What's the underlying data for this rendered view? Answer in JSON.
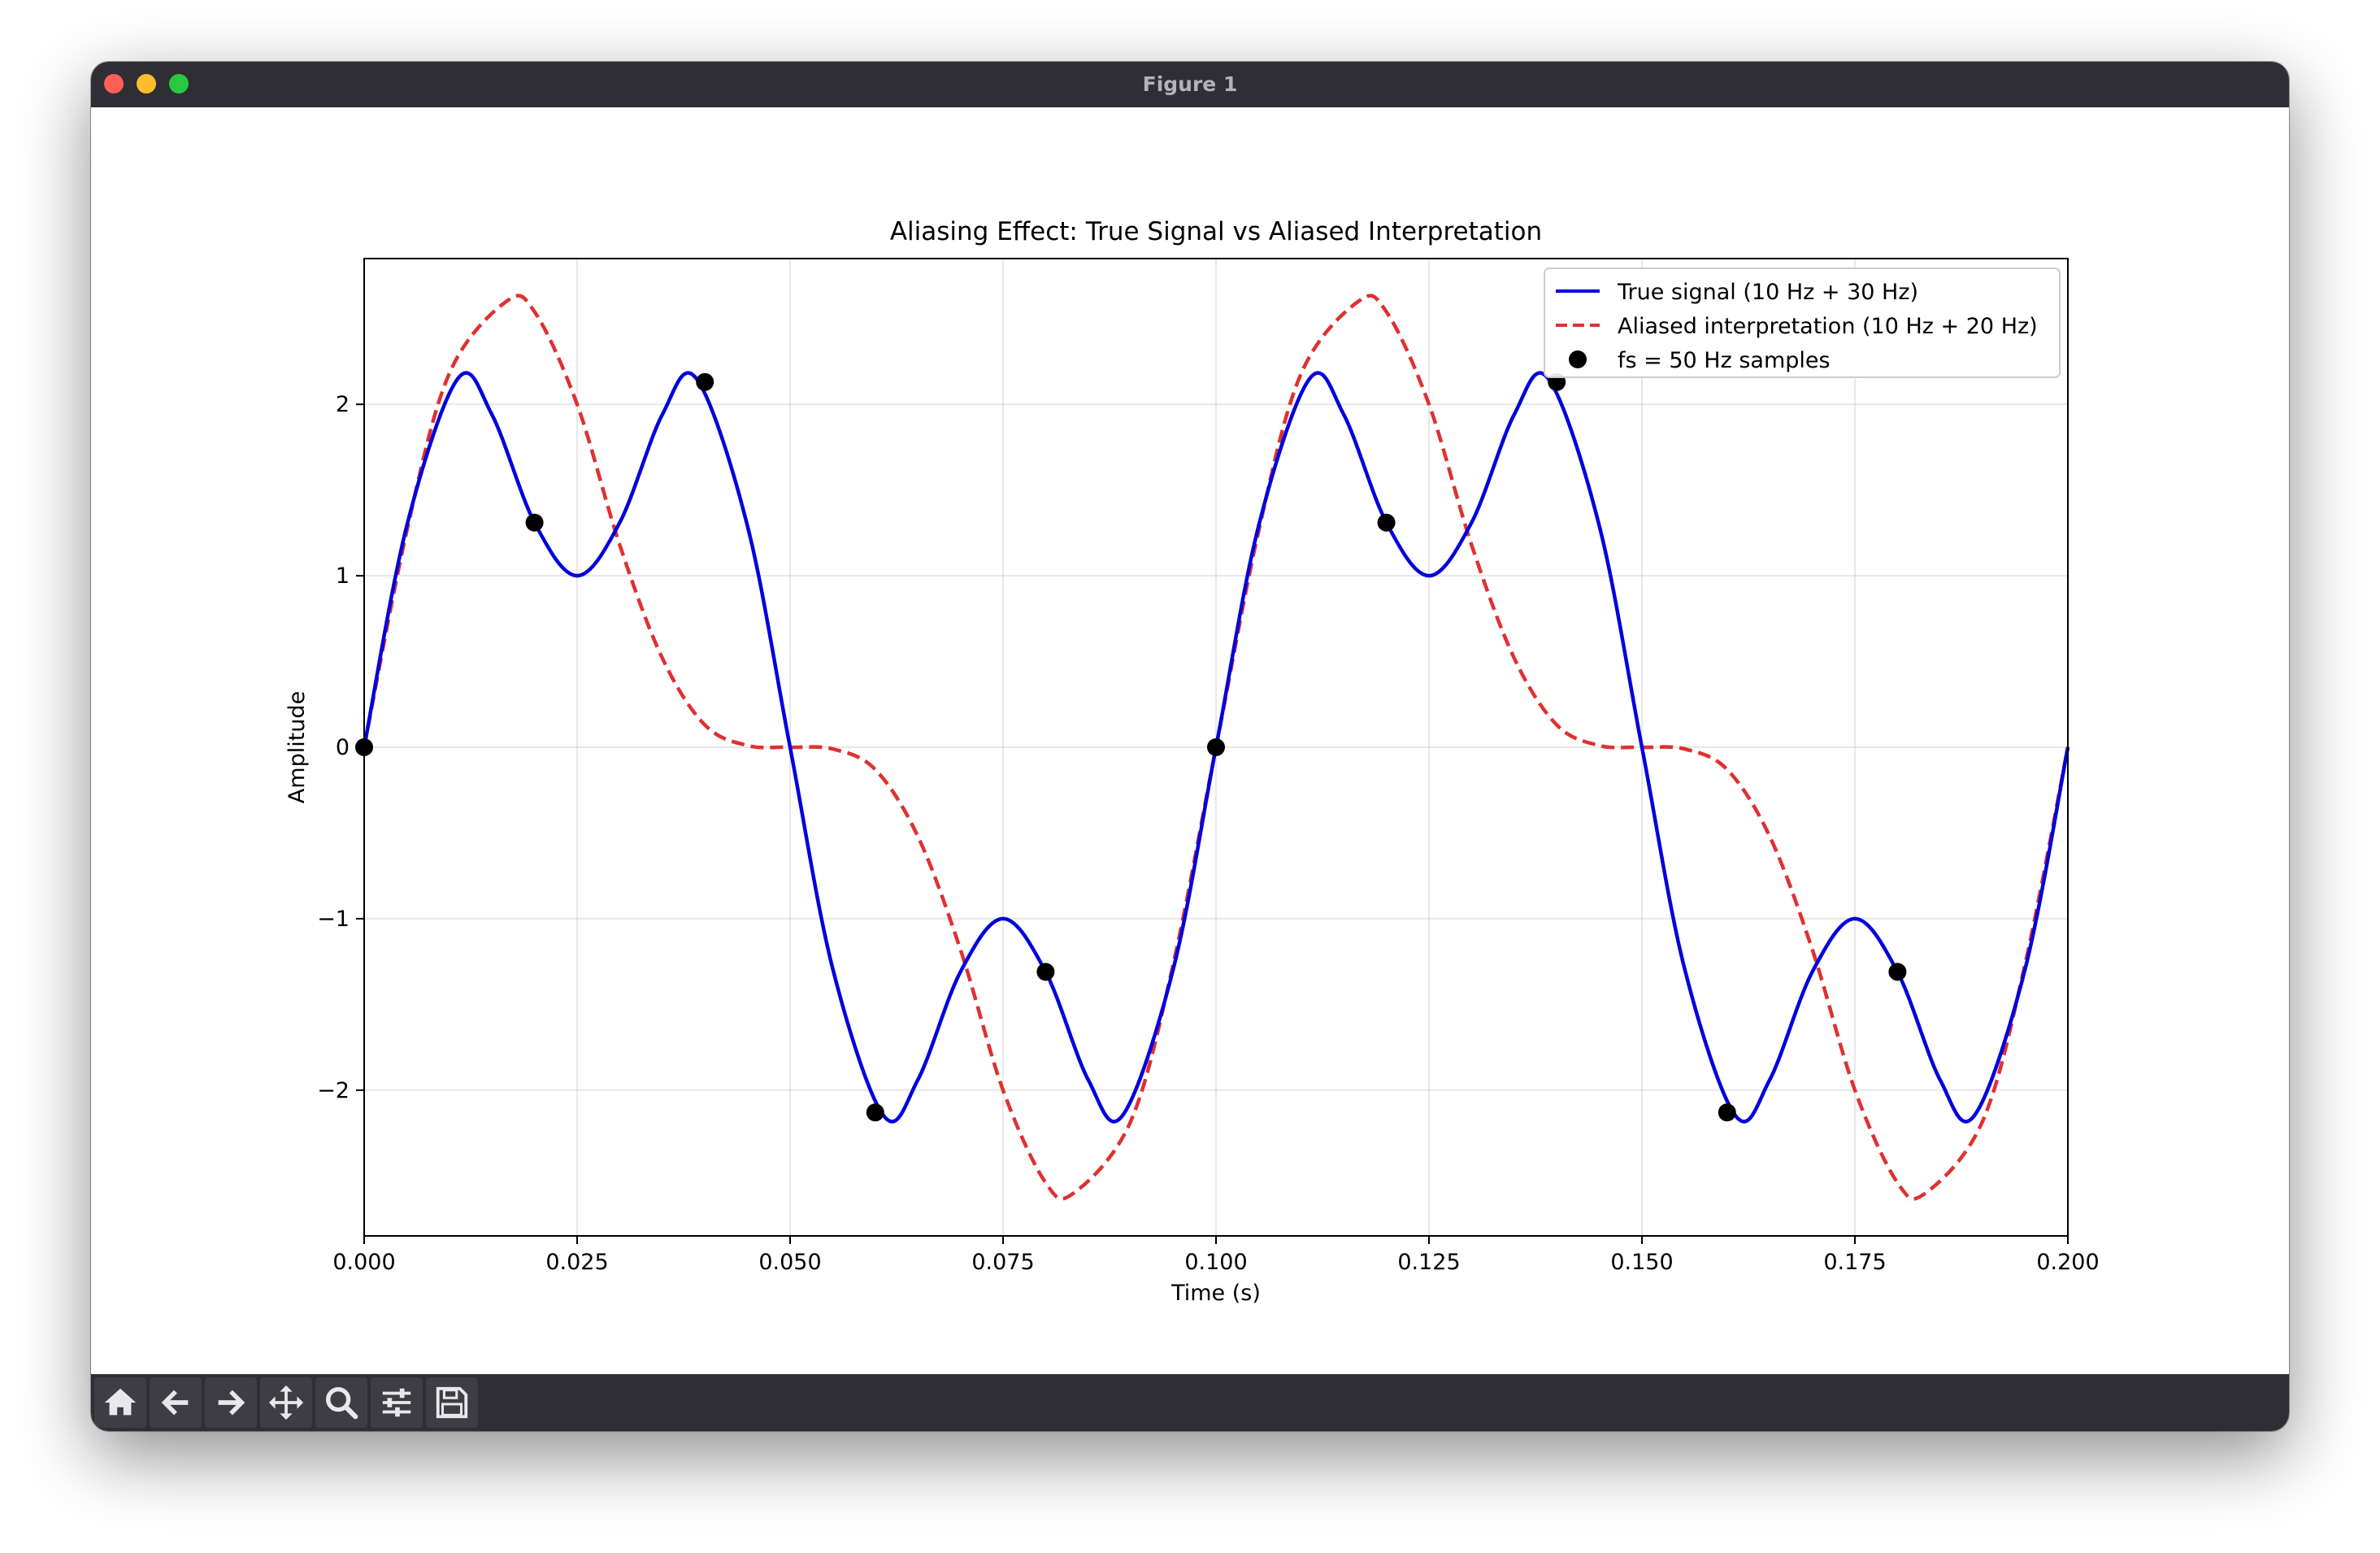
{
  "window": {
    "title": "Figure 1"
  },
  "toolbar": {
    "buttons": [
      {
        "name": "home-button",
        "icon": "home-icon"
      },
      {
        "name": "back-button",
        "icon": "arrow-left-icon"
      },
      {
        "name": "forward-button",
        "icon": "arrow-right-icon"
      },
      {
        "name": "pan-button",
        "icon": "move-icon"
      },
      {
        "name": "zoom-button",
        "icon": "magnifier-icon"
      },
      {
        "name": "configure-subplots-button",
        "icon": "sliders-icon"
      },
      {
        "name": "save-button",
        "icon": "floppy-disk-icon"
      }
    ]
  },
  "chart_data": {
    "type": "line",
    "title": "Aliasing Effect: True Signal vs Aliased Interpretation",
    "xlabel": "Time (s)",
    "ylabel": "Amplitude",
    "xlim": [
      0.0,
      0.2
    ],
    "ylim": [
      -2.85,
      2.85
    ],
    "xticks": [
      0.0,
      0.025,
      0.05,
      0.075,
      0.1,
      0.125,
      0.15,
      0.175,
      0.2
    ],
    "xtick_labels": [
      "0.000",
      "0.025",
      "0.050",
      "0.075",
      "0.100",
      "0.125",
      "0.150",
      "0.175",
      "0.200"
    ],
    "yticks": [
      -2,
      -1,
      0,
      1,
      2
    ],
    "ytick_labels": [
      "−2",
      "−1",
      "0",
      "1",
      "2"
    ],
    "grid": true,
    "legend_position": "top-right",
    "series": [
      {
        "name": "True signal (10 Hz + 30 Hz)",
        "style": "solid",
        "color": "#0000dd",
        "x": [
          0.0,
          0.005,
          0.011,
          0.015,
          0.02,
          0.025,
          0.03,
          0.035,
          0.039,
          0.045,
          0.05,
          0.055,
          0.061,
          0.065,
          0.07,
          0.075,
          0.08,
          0.085,
          0.089,
          0.095,
          0.1,
          0.105,
          0.111,
          0.115,
          0.12,
          0.125,
          0.13,
          0.135,
          0.139,
          0.145,
          0.15,
          0.155,
          0.161,
          0.165,
          0.17,
          0.175,
          0.18,
          0.185,
          0.189,
          0.195,
          0.2
        ],
        "y": [
          0.0,
          1.29,
          2.15,
          1.94,
          1.31,
          1.0,
          1.31,
          1.94,
          2.15,
          1.29,
          0.0,
          -1.29,
          -2.15,
          -1.94,
          -1.31,
          -1.0,
          -1.31,
          -1.94,
          -2.15,
          -1.29,
          0.0,
          1.29,
          2.15,
          1.94,
          1.31,
          1.0,
          1.31,
          1.94,
          2.15,
          1.29,
          0.0,
          -1.29,
          -2.15,
          -1.94,
          -1.31,
          -1.0,
          -1.31,
          -1.94,
          -2.15,
          -1.29,
          0.0
        ]
      },
      {
        "name": "Aliased interpretation (10 Hz + 20 Hz)",
        "style": "dashed",
        "color": "#e03030",
        "x": [
          0.0,
          0.005,
          0.01,
          0.0167,
          0.02,
          0.025,
          0.03,
          0.035,
          0.04,
          0.045,
          0.05,
          0.055,
          0.06,
          0.065,
          0.07,
          0.075,
          0.08,
          0.0833,
          0.09,
          0.095,
          0.1,
          0.105,
          0.11,
          0.1167,
          0.12,
          0.125,
          0.13,
          0.135,
          0.14,
          0.145,
          0.15,
          0.155,
          0.16,
          0.165,
          0.17,
          0.175,
          0.18,
          0.1833,
          0.19,
          0.195,
          0.2
        ],
        "y": [
          0.0,
          1.26,
          2.18,
          2.6,
          2.54,
          2.0,
          1.18,
          0.52,
          0.13,
          0.01,
          0.0,
          -0.01,
          -0.13,
          -0.52,
          -1.18,
          -2.0,
          -2.54,
          -2.6,
          -2.18,
          -1.26,
          0.0,
          1.26,
          2.18,
          2.6,
          2.54,
          2.0,
          1.18,
          0.52,
          0.13,
          0.01,
          0.0,
          -0.01,
          -0.13,
          -0.52,
          -1.18,
          -2.0,
          -2.54,
          -2.6,
          -2.18,
          -1.26,
          0.0
        ]
      },
      {
        "name": "fs = 50 Hz samples",
        "style": "markers",
        "color": "#000000",
        "x": [
          0.0,
          0.02,
          0.04,
          0.06,
          0.08,
          0.1,
          0.12,
          0.14,
          0.16,
          0.18
        ],
        "y": [
          0.0,
          1.31,
          2.13,
          -2.13,
          -1.31,
          0.0,
          1.31,
          2.13,
          -2.13,
          -1.31
        ]
      }
    ]
  }
}
